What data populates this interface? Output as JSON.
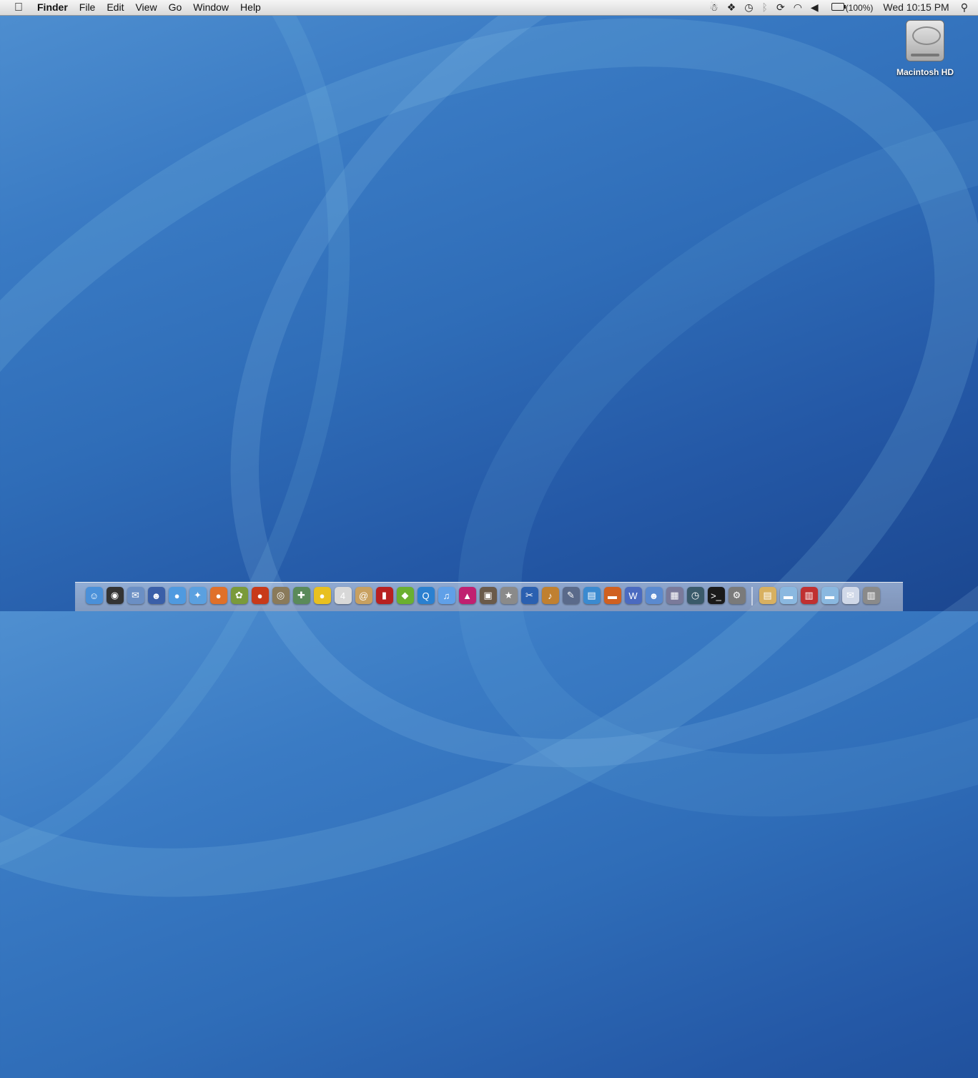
{
  "menubar": {
    "apple_icon": "apple-icon",
    "app_name": "Finder",
    "menus": [
      "File",
      "Edit",
      "View",
      "Go",
      "Window",
      "Help"
    ],
    "status": {
      "icons": [
        "growl-icon",
        "dropbox-icon",
        "time-machine-icon",
        "bluetooth-icon",
        "sync-icon",
        "wifi-icon",
        "volume-icon",
        "battery-icon"
      ],
      "battery_text": "(100%)",
      "clock": "Wed 10:15 PM",
      "spotlight_icon": "spotlight-icon"
    }
  },
  "desktop": {
    "hd_label": "Macintosh HD"
  },
  "dock": {
    "apps": [
      {
        "name": "finder-icon",
        "color": "#4a90d9",
        "glyph": "☺"
      },
      {
        "name": "dashboard-icon",
        "color": "#333333",
        "glyph": "◉"
      },
      {
        "name": "mail-icon",
        "color": "#6b8fc4",
        "glyph": "✉"
      },
      {
        "name": "adium-icon",
        "color": "#3a5fa8",
        "glyph": "☻"
      },
      {
        "name": "ichat-icon",
        "color": "#4f9ae0",
        "glyph": "●"
      },
      {
        "name": "safari-icon",
        "color": "#5aa0e0",
        "glyph": "✦"
      },
      {
        "name": "firefox-icon",
        "color": "#e0702a",
        "glyph": "●"
      },
      {
        "name": "cyberduck-icon",
        "color": "#7a9a3a",
        "glyph": "✿"
      },
      {
        "name": "camino-icon",
        "color": "#c83a1a",
        "glyph": "●"
      },
      {
        "name": "owl-icon",
        "color": "#8a7a5a",
        "glyph": "◎"
      },
      {
        "name": "stickies-icon",
        "color": "#5a8a5a",
        "glyph": "✚"
      },
      {
        "name": "duck-icon",
        "color": "#e8c020",
        "glyph": "●"
      },
      {
        "name": "ical-icon",
        "color": "#d8d8d8",
        "glyph": "4"
      },
      {
        "name": "address-book-icon",
        "color": "#c8a060",
        "glyph": "@"
      },
      {
        "name": "photo-booth-icon",
        "color": "#b82020",
        "glyph": "▮"
      },
      {
        "name": "evernote-icon",
        "color": "#6ab030",
        "glyph": "◆"
      },
      {
        "name": "quicktime-icon",
        "color": "#2a80d0",
        "glyph": "Q"
      },
      {
        "name": "itunes-icon",
        "color": "#60a0e8",
        "glyph": "♫"
      },
      {
        "name": "iphoto-icon",
        "color": "#c02070",
        "glyph": "▲"
      },
      {
        "name": "preview-icon",
        "color": "#6a5a4a",
        "glyph": "▣"
      },
      {
        "name": "imovie-icon",
        "color": "#8a8a8a",
        "glyph": "★"
      },
      {
        "name": "final-cut-icon",
        "color": "#2a60b0",
        "glyph": "✂"
      },
      {
        "name": "garageband-icon",
        "color": "#c08030",
        "glyph": "♪"
      },
      {
        "name": "iweb-icon",
        "color": "#5a6a8a",
        "glyph": "✎"
      },
      {
        "name": "numbers-icon",
        "color": "#3a8ad0",
        "glyph": "▤"
      },
      {
        "name": "keynote-icon",
        "color": "#d06020",
        "glyph": "▬"
      },
      {
        "name": "textmate-icon",
        "color": "#4a6ac0",
        "glyph": "W"
      },
      {
        "name": "people-icon",
        "color": "#5a8ad0",
        "glyph": "☻"
      },
      {
        "name": "image-capture-icon",
        "color": "#7a7a9a",
        "glyph": "▦"
      },
      {
        "name": "time-machine-app-icon",
        "color": "#3a5a6a",
        "glyph": "◷"
      },
      {
        "name": "terminal-icon",
        "color": "#1a1a1a",
        "glyph": ">_"
      },
      {
        "name": "system-prefs-icon",
        "color": "#7a7a7a",
        "glyph": "⚙"
      }
    ],
    "stacks": [
      {
        "name": "documents-stack-icon",
        "color": "#d8b060",
        "glyph": "▤"
      },
      {
        "name": "folder-icon",
        "color": "#8ab8e0",
        "glyph": "▬"
      },
      {
        "name": "pdf-stack-icon",
        "color": "#c03030",
        "glyph": "▥"
      },
      {
        "name": "folder-2-icon",
        "color": "#8ab8e0",
        "glyph": "▬"
      },
      {
        "name": "mail-stack-icon",
        "color": "#d0d8e8",
        "glyph": "✉"
      },
      {
        "name": "trash-icon",
        "color": "#8a8a8a",
        "glyph": "▥"
      }
    ]
  }
}
